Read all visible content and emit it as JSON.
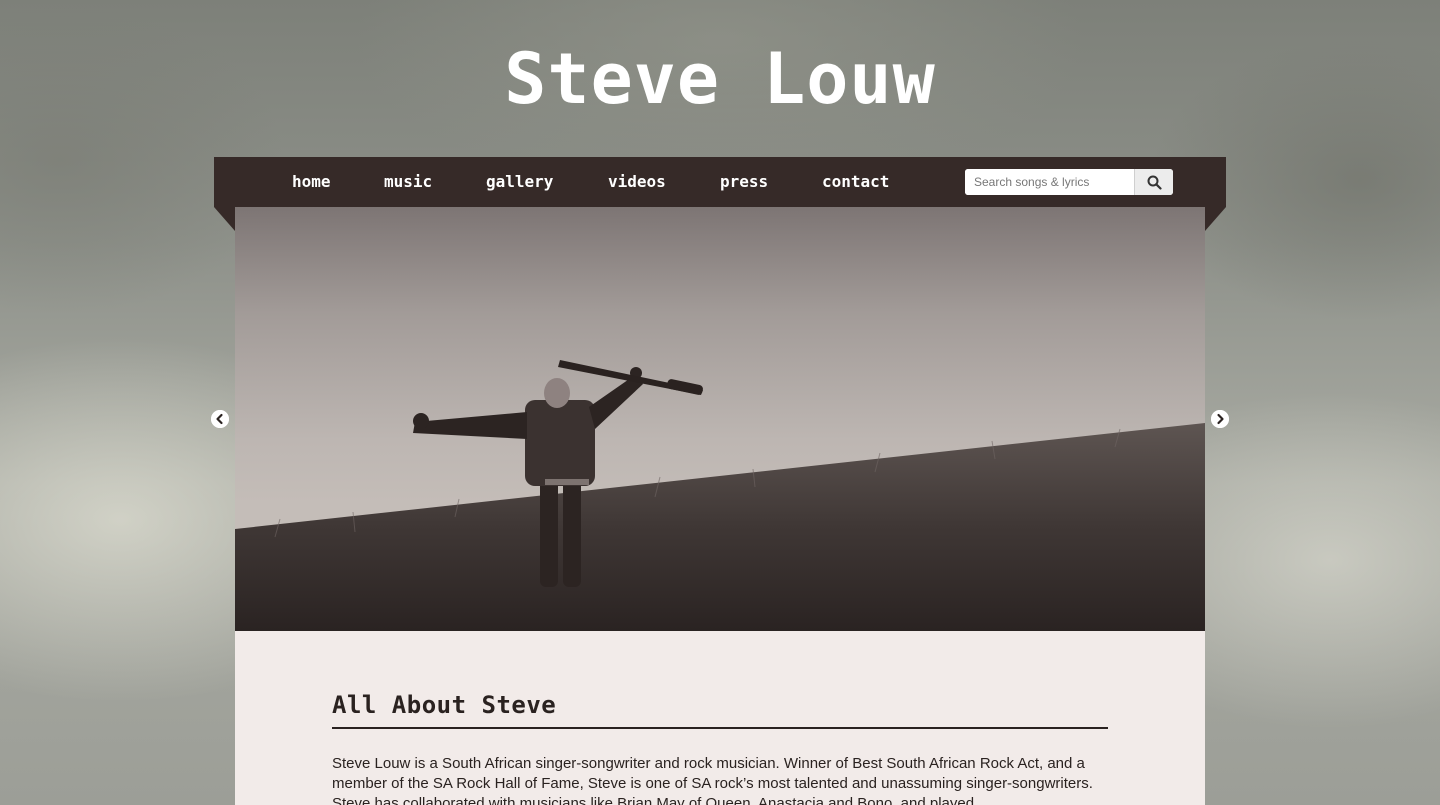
{
  "site": {
    "title": "Steve Louw"
  },
  "nav": {
    "items": [
      {
        "label": "home"
      },
      {
        "label": "music"
      },
      {
        "label": "gallery"
      },
      {
        "label": "videos"
      },
      {
        "label": "press"
      },
      {
        "label": "contact"
      }
    ]
  },
  "search": {
    "placeholder": "Search songs & lyrics",
    "button_icon": "search-icon"
  },
  "carousel": {
    "prev_icon": "chevron-left-circle-icon",
    "next_icon": "chevron-right-circle-icon"
  },
  "about": {
    "heading": "All About Steve",
    "body": "Steve Louw is a South African singer-songwriter and rock musician. Winner of Best South African Rock Act, and a member of the SA Rock Hall of Fame, Steve is one of SA rock’s most talented and unassuming singer-songwriters. Steve has collaborated with musicians like Brian May of Queen, Anastacia and Bono, and played"
  },
  "colors": {
    "nav_background": "#362a28",
    "content_background": "#f2ebe9",
    "text": "#2a2220"
  }
}
